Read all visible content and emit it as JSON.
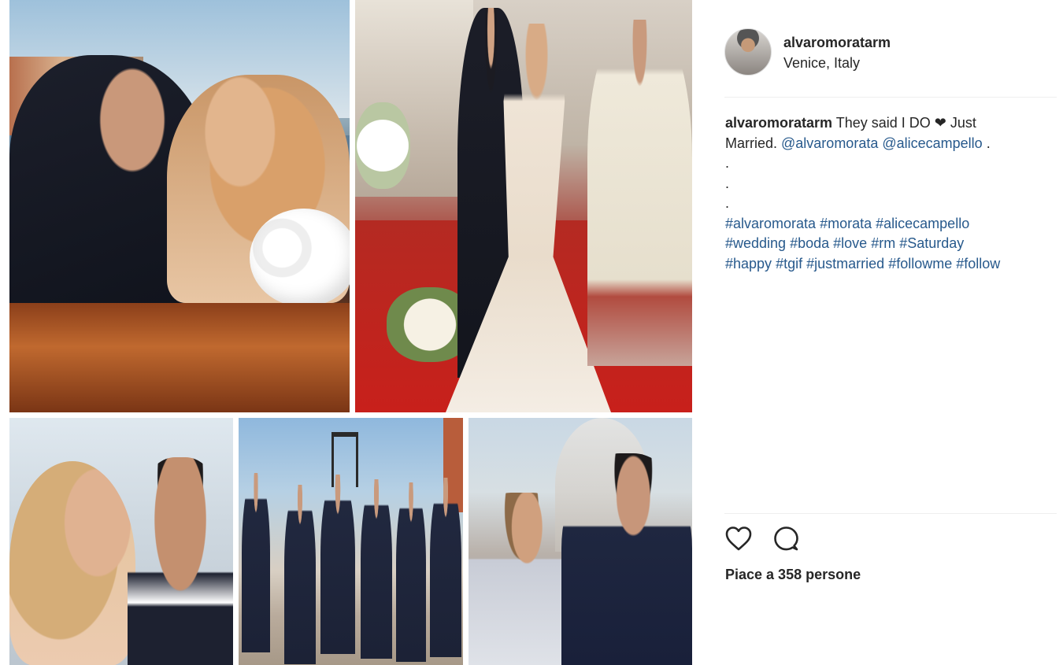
{
  "post": {
    "username": "alvaromoratarm",
    "location": "Venice, Italy",
    "caption": {
      "username": "alvaromoratarm",
      "text_1": " They said I DO ",
      "heart": "❤",
      "text_2": " Just",
      "text_3": "Married. ",
      "mention_1": "@alvaromorata",
      "mention_2": "@alicecampello",
      "text_4": " .",
      "dots": [
        ".",
        ".",
        "."
      ],
      "hashtags_line_1": [
        "#alvaromorata",
        "#morata",
        "#alicecampello"
      ],
      "hashtags_line_2": [
        "#wedding",
        "#boda",
        "#love",
        "#rm",
        "#Saturday"
      ],
      "hashtags_line_3": [
        "#happy",
        "#tgif",
        "#justmarried",
        "#followme",
        "#follow"
      ]
    },
    "likes_text": "Piace a 358 persone"
  },
  "actions": {
    "like_icon": "heart-outline-icon",
    "comment_icon": "comment-bubble-icon"
  },
  "colors": {
    "link": "#27598c",
    "text": "#262626",
    "divider": "#efefef"
  }
}
